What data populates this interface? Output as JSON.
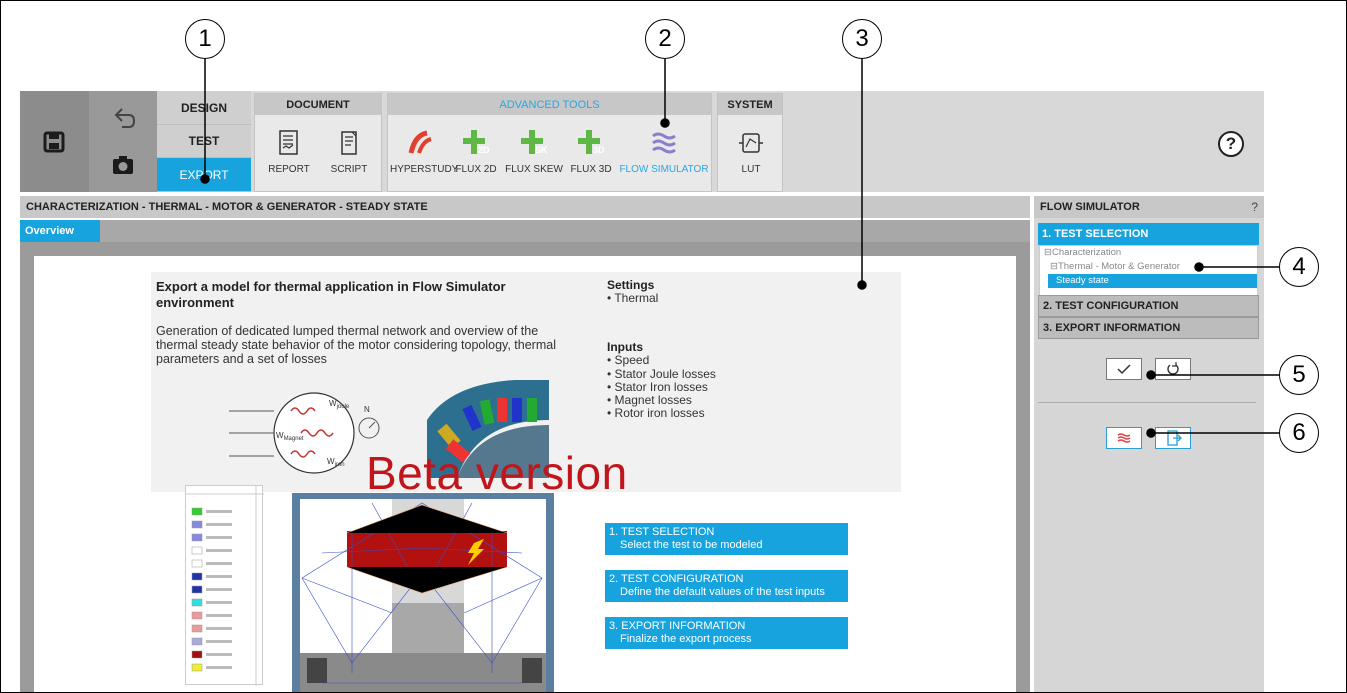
{
  "ribbon": {
    "modes": {
      "design": "DESIGN",
      "test": "TEST",
      "export": "EXPORT"
    },
    "groups": {
      "document": {
        "title": "DOCUMENT",
        "tools": [
          "REPORT",
          "SCRIPT"
        ]
      },
      "advanced": {
        "title": "ADVANCED TOOLS",
        "tools": [
          "HYPERSTUDY",
          "FLUX 2D",
          "FLUX SKEW",
          "FLUX 3D",
          "FLOW SIMULATOR"
        ]
      },
      "system": {
        "title": "SYSTEM",
        "tools": [
          "LUT"
        ]
      }
    },
    "help": "?"
  },
  "main": {
    "breadcrumb": "CHARACTERIZATION - THERMAL - MOTOR & GENERATOR - STEADY STATE",
    "tab": "Overview",
    "doc": {
      "title": "Export a model for thermal application in Flow Simulator environment",
      "description": "Generation of dedicated lumped thermal network and overview of the thermal steady state behavior of the motor considering topology, thermal parameters and a set of losses",
      "settings_title": "Settings",
      "settings": [
        "Thermal"
      ],
      "inputs_title": "Inputs",
      "inputs": [
        "Speed",
        "Stator Joule losses",
        "Stator Iron losses",
        "Magnet losses",
        "Rotor iron losses"
      ],
      "watermark": "Beta version",
      "diagram_labels": {
        "joule": "W",
        "joule_sub": "joule",
        "magnet": "W",
        "magnet_sub": "Magnet",
        "iron": "W",
        "iron_sub": "iron",
        "n": "N"
      },
      "steps": [
        {
          "title": "1. TEST SELECTION",
          "desc": "Select the test to be modeled"
        },
        {
          "title": "2. TEST CONFIGURATION",
          "desc": "Define the default values of the test inputs"
        },
        {
          "title": "3. EXPORT INFORMATION",
          "desc": "Finalize the export process"
        }
      ]
    }
  },
  "panel": {
    "title": "FLOW SIMULATOR",
    "help": "?",
    "step1": "1. TEST SELECTION",
    "tree": {
      "root": "Characterization",
      "child": "Thermal - Motor & Generator",
      "selected": "Steady state"
    },
    "step2": "2. TEST CONFIGURATION",
    "step3": "3. EXPORT INFORMATION"
  },
  "callouts": [
    "1",
    "2",
    "3",
    "4",
    "5",
    "6"
  ],
  "colors": {
    "accent": "#17a3dd",
    "beta": "#c0161b",
    "ribbon": "#d8d8d8"
  }
}
